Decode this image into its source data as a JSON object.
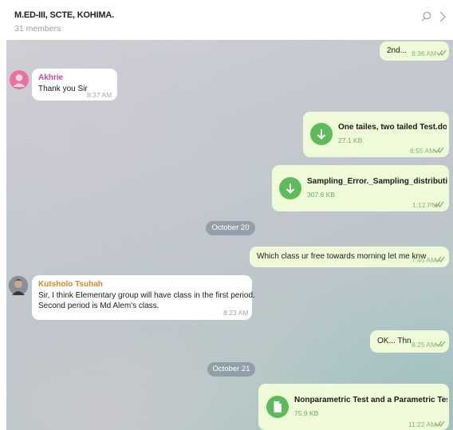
{
  "header": {
    "title": "M.ED-III, SCTE, KOHIMA.",
    "members": "31 members",
    "search_icon": "search-icon",
    "more_icon": "chevron-right-icon"
  },
  "colors": {
    "outgoing_bubble": "#eefad8",
    "incoming_bubble": "#ffffff",
    "accent_green": "#5dbb5a",
    "sender_akhrie": "#d04a8e",
    "sender_kutsholo": "#e0862a"
  },
  "messages": {
    "m1": {
      "text": "2nd...",
      "time": "8:36 AM",
      "status": "read"
    },
    "m2": {
      "sender": "Akhrie",
      "text": "Thank you Sir",
      "time": "8:37 AM"
    },
    "m3": {
      "file_name": "One tailes, two tailed Test.docx",
      "file_size": "27.1 KB",
      "time": "8:55 AM",
      "status": "read"
    },
    "m4": {
      "file_name": "Sampling_Error._Sampling_distribution.d...",
      "file_size": "307.6 KB",
      "time": "1:12 PM",
      "status": "read"
    },
    "date1": "October 20",
    "m5": {
      "text": "Which class ur free towards morning let me knw",
      "time": "7:45 AM",
      "status": "read"
    },
    "m6": {
      "sender": "Kutsholo Tsuhah",
      "line1": "Sir, I think Elementary group will have class in the first period.",
      "line2": "Second period is Md Alem's class.",
      "time": "8:23 AM"
    },
    "m7": {
      "text": "OK... Thn",
      "time": "8:25 AM",
      "status": "read"
    },
    "date2": "October 21",
    "m8": {
      "file_name": "Nonparametric Test and a Parametric Test.d...",
      "file_size": "75.9 KB",
      "time": "11:22 AM",
      "status": "read"
    }
  }
}
